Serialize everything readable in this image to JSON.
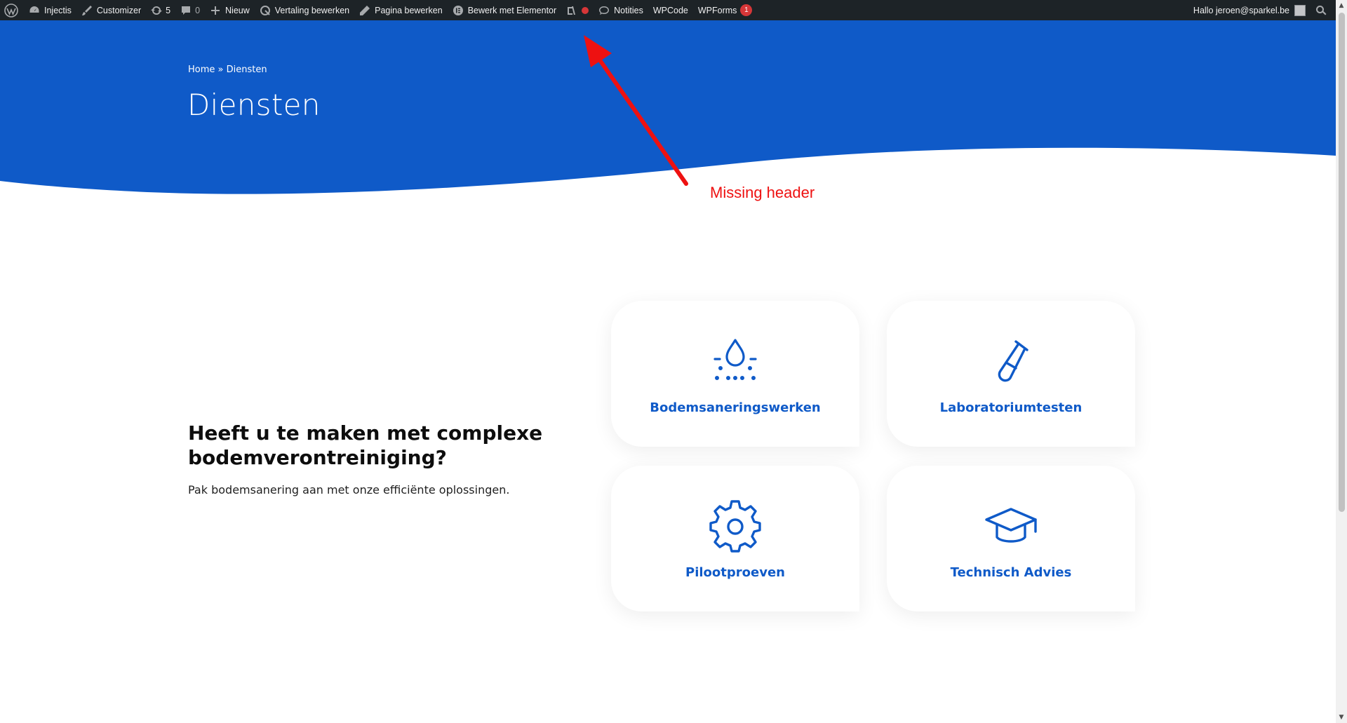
{
  "adminbar": {
    "site_name": "Injectis",
    "customizer": "Customizer",
    "updates_count": "5",
    "comments_count": "0",
    "new": "Nieuw",
    "edit_translation": "Vertaling bewerken",
    "edit_page": "Pagina bewerken",
    "edit_elementor": "Bewerk met Elementor",
    "notes": "Notities",
    "wpcode": "WPCode",
    "wpforms": "WPForms",
    "wpforms_badge": "1",
    "greeting": "Hallo jeroen@sparkel.be"
  },
  "hero": {
    "breadcrumb": "Home » Diensten",
    "title": "Diensten",
    "color": "#0f5ac8"
  },
  "annotation": {
    "label": "Missing header",
    "color": "#ee1111"
  },
  "intro": {
    "heading": "Heeft u te maken met complexe bodemverontreiniging?",
    "text": "Pak bodemsanering aan met onze efficiënte oplossingen."
  },
  "services": [
    {
      "label": "Bodemsaneringswerken",
      "icon": "water-drop-icon"
    },
    {
      "label": "Laboratoriumtesten",
      "icon": "test-tube-icon"
    },
    {
      "label": "Pilootproeven",
      "icon": "gear-icon"
    },
    {
      "label": "Technisch Advies",
      "icon": "graduation-cap-icon"
    }
  ],
  "accent_color": "#0f5ac8"
}
